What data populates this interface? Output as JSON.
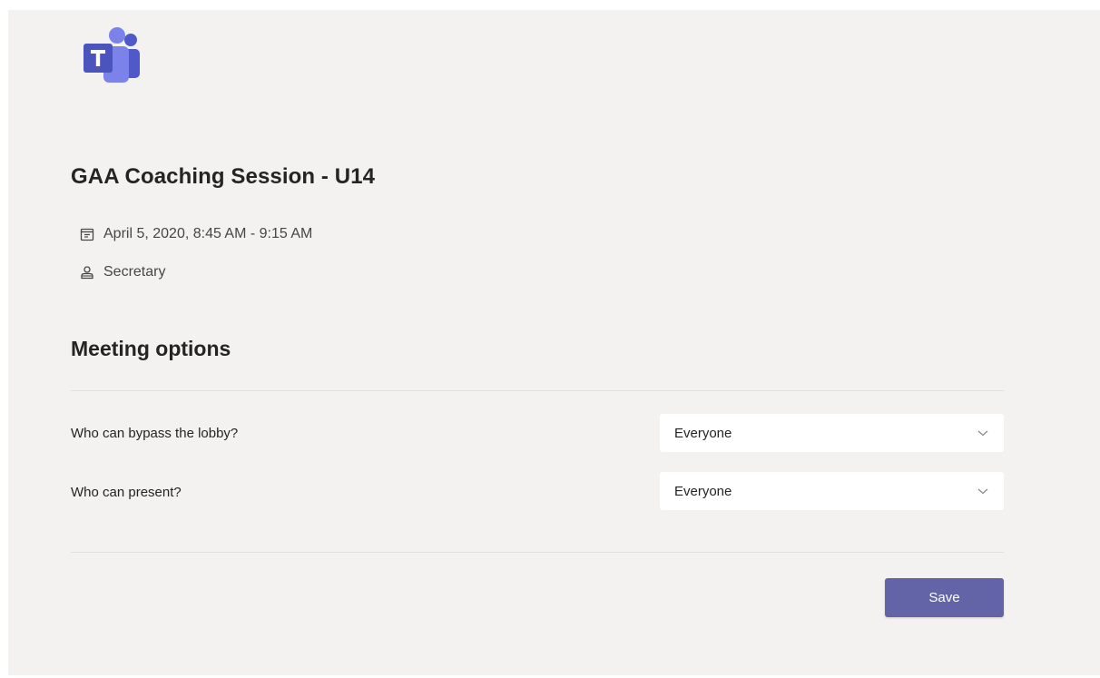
{
  "meeting": {
    "title": "GAA Coaching Session - U14",
    "datetime": "April 5, 2020, 8:45 AM - 9:15 AM",
    "organizer": "Secretary"
  },
  "options": {
    "heading": "Meeting options",
    "items": [
      {
        "label": "Who can bypass the lobby?",
        "value": "Everyone"
      },
      {
        "label": "Who can present?",
        "value": "Everyone"
      }
    ]
  },
  "actions": {
    "save_label": "Save"
  },
  "colors": {
    "brand": "#6264a7",
    "background": "#f3f2f1"
  },
  "icons": {
    "logo": "microsoft-teams-logo",
    "date": "calendar-icon",
    "organizer": "person-icon",
    "dropdown": "chevron-down-icon"
  }
}
